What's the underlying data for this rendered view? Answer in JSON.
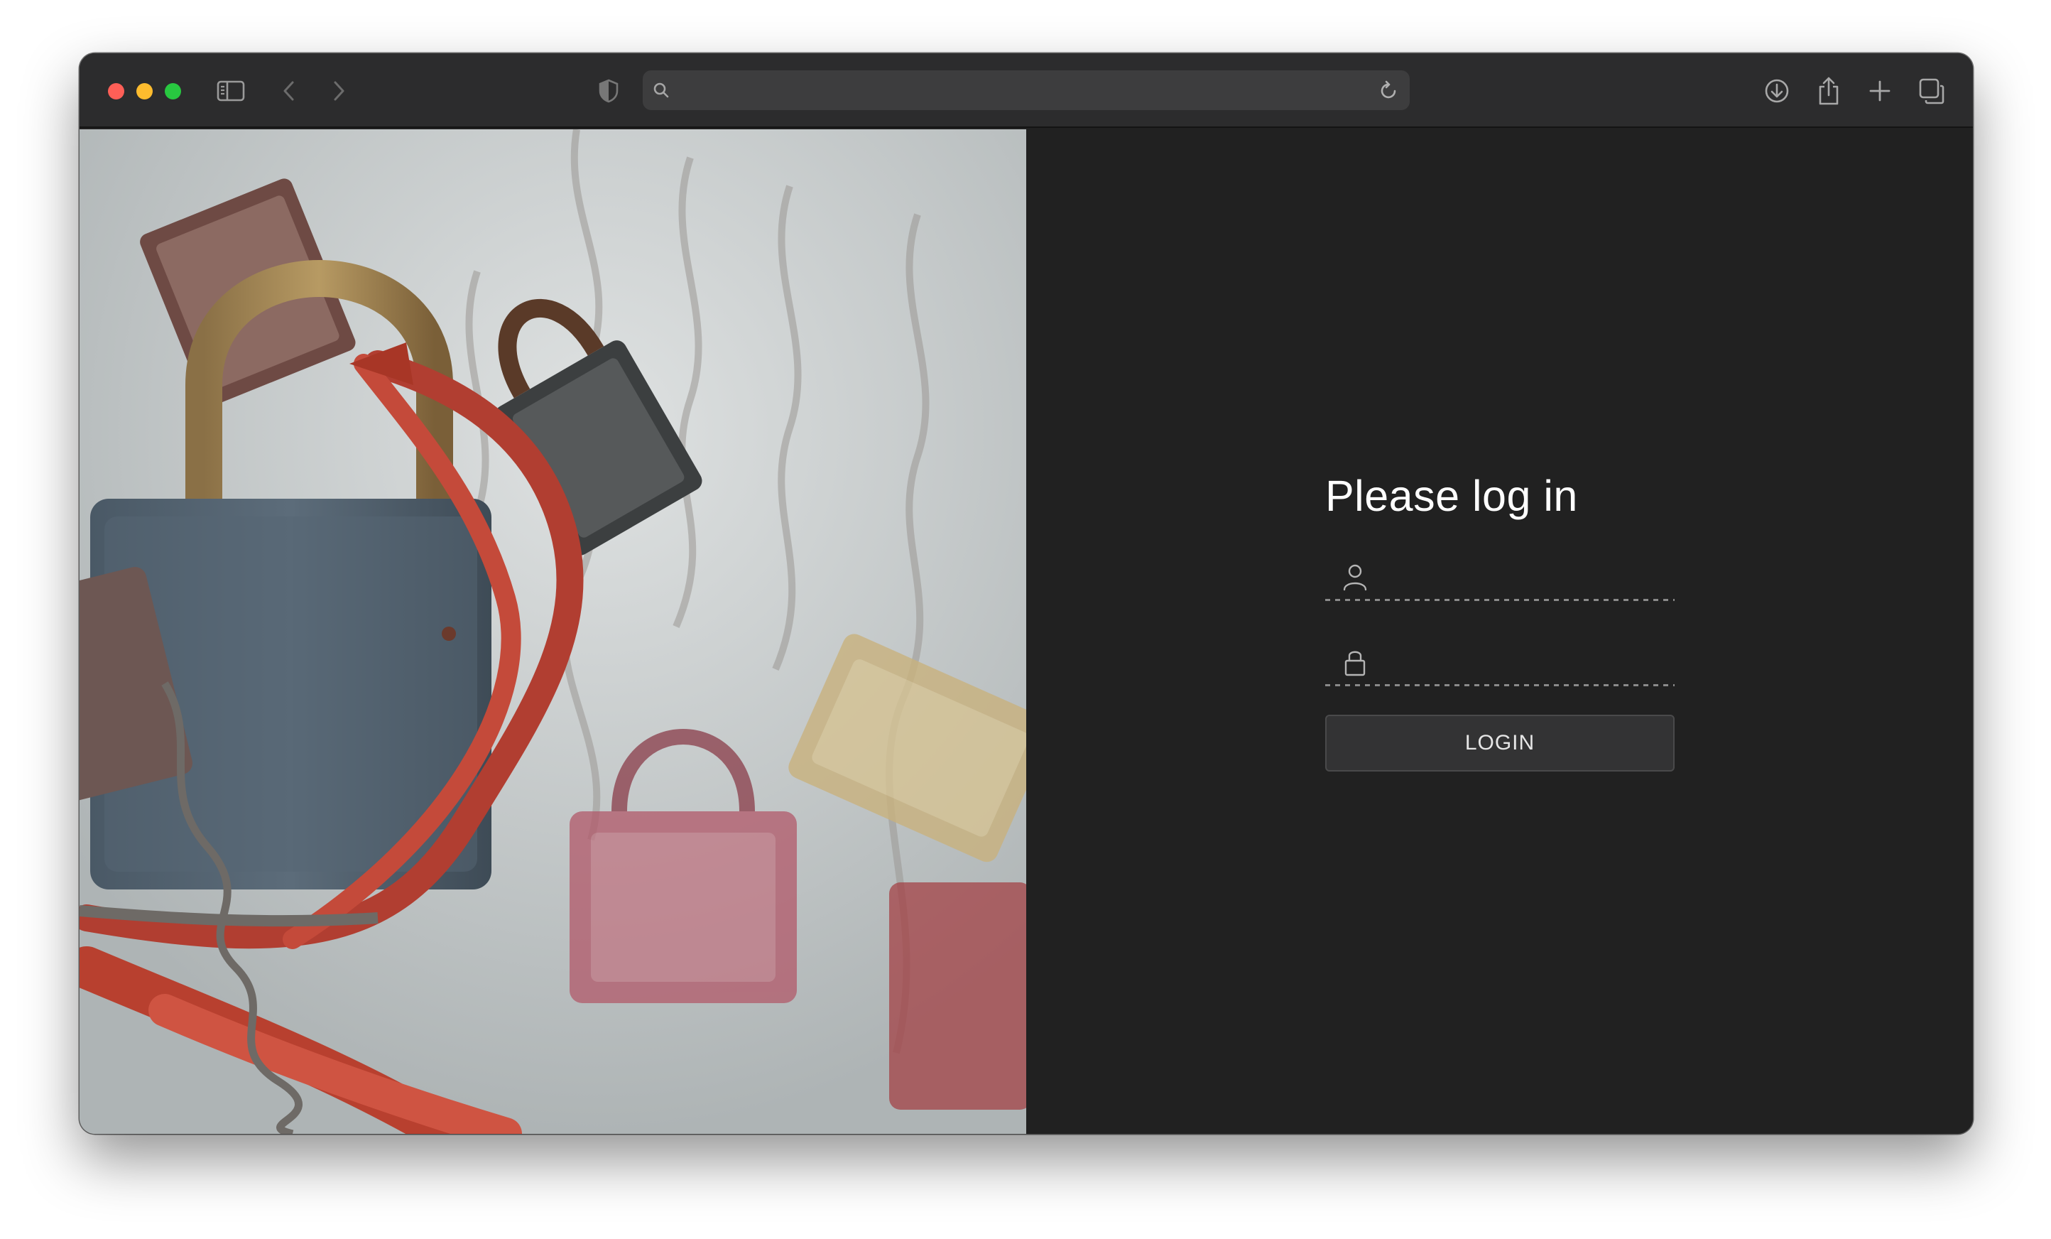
{
  "browser": {
    "url_text": ""
  },
  "login": {
    "title": "Please log in",
    "username_placeholder": "",
    "password_placeholder": "",
    "button_label": "LOGIN"
  },
  "colors": {
    "traffic_close": "#ff5f57",
    "traffic_minimize": "#febc2e",
    "traffic_maximize": "#28c840",
    "toolbar_bg": "#2c2c2d",
    "panel_bg": "#212121",
    "button_bg": "#333334"
  },
  "icons": {
    "toolbar": [
      "sidebar-icon",
      "chevron-left-icon",
      "chevron-right-icon",
      "shield-icon",
      "search-icon",
      "reload-icon",
      "download-icon",
      "share-icon",
      "plus-icon",
      "tabs-icon"
    ],
    "fields": [
      "user-icon",
      "lock-icon"
    ]
  }
}
